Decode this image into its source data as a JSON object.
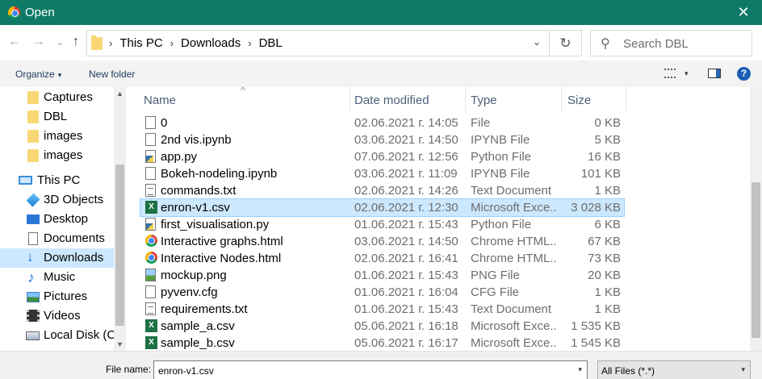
{
  "window": {
    "title": "Open",
    "close_glyph": "✕"
  },
  "nav": {
    "back_glyph": "←",
    "forward_glyph": "→",
    "recent_glyph": "⌄",
    "up_glyph": "↑"
  },
  "breadcrumb": {
    "items": [
      "This PC",
      "Downloads",
      "DBL"
    ],
    "separator": "›",
    "dropdown_glyph": "⌄"
  },
  "refresh_glyph": "↻",
  "search": {
    "placeholder": "Search DBL",
    "icon_glyph": "⚲"
  },
  "toolbar": {
    "organize": "Organize",
    "new_folder": "New folder",
    "caret": "▾",
    "help": "?"
  },
  "sidebar": {
    "items": [
      {
        "label": "Captures",
        "icon": "folder-icon"
      },
      {
        "label": "DBL",
        "icon": "folder-icon"
      },
      {
        "label": "images",
        "icon": "folder-icon"
      },
      {
        "label": "images",
        "icon": "folder-icon"
      },
      {
        "label": "This PC",
        "icon": "computer-icon"
      },
      {
        "label": "3D Objects",
        "icon": "3d-objects-icon"
      },
      {
        "label": "Desktop",
        "icon": "desktop-icon"
      },
      {
        "label": "Documents",
        "icon": "documents-icon"
      },
      {
        "label": "Downloads",
        "icon": "downloads-icon",
        "selected": true
      },
      {
        "label": "Music",
        "icon": "music-icon"
      },
      {
        "label": "Pictures",
        "icon": "pictures-icon"
      },
      {
        "label": "Videos",
        "icon": "videos-icon"
      },
      {
        "label": "Local Disk (C",
        "icon": "local-disk-icon"
      }
    ]
  },
  "columns": {
    "name": "Name",
    "date": "Date modified",
    "type": "Type",
    "size": "Size",
    "sort_glyph": "^"
  },
  "files": [
    {
      "name": "0",
      "date": "02.06.2021 г. 14:05",
      "type": "File",
      "size": "0 KB",
      "icon": "file-icon"
    },
    {
      "name": "2nd vis.ipynb",
      "date": "03.06.2021 г. 14:50",
      "type": "IPYNB File",
      "size": "5 KB",
      "icon": "file-icon"
    },
    {
      "name": "app.py",
      "date": "07.06.2021 г. 12:56",
      "type": "Python File",
      "size": "16 KB",
      "icon": "python-file-icon"
    },
    {
      "name": "Bokeh-nodeling.ipynb",
      "date": "03.06.2021 г. 11:09",
      "type": "IPYNB File",
      "size": "101 KB",
      "icon": "file-icon"
    },
    {
      "name": "commands.txt",
      "date": "02.06.2021 г. 14:26",
      "type": "Text Document",
      "size": "1 KB",
      "icon": "text-file-icon"
    },
    {
      "name": "enron-v1.csv",
      "date": "02.06.2021 г. 12:30",
      "type": "Microsoft Exce...",
      "size": "3 028 KB",
      "icon": "excel-file-icon",
      "selected": true
    },
    {
      "name": "first_visualisation.py",
      "date": "01.06.2021 г. 15:43",
      "type": "Python File",
      "size": "6 KB",
      "icon": "python-file-icon"
    },
    {
      "name": "Interactive graphs.html",
      "date": "03.06.2021 г. 14:50",
      "type": "Chrome HTML...",
      "size": "67 KB",
      "icon": "chrome-html-icon"
    },
    {
      "name": "Interactive Nodes.html",
      "date": "02.06.2021 г. 16:41",
      "type": "Chrome HTML...",
      "size": "73 KB",
      "icon": "chrome-html-icon"
    },
    {
      "name": "mockup.png",
      "date": "01.06.2021 г. 15:43",
      "type": "PNG File",
      "size": "20 KB",
      "icon": "image-file-icon"
    },
    {
      "name": "pyvenv.cfg",
      "date": "01.06.2021 г. 16:04",
      "type": "CFG File",
      "size": "1 KB",
      "icon": "file-icon"
    },
    {
      "name": "requirements.txt",
      "date": "01.06.2021 г. 15:43",
      "type": "Text Document",
      "size": "1 KB",
      "icon": "text-file-icon"
    },
    {
      "name": "sample_a.csv",
      "date": "05.06.2021 г. 16:18",
      "type": "Microsoft Exce...",
      "size": "1 535 KB",
      "icon": "excel-file-icon"
    },
    {
      "name": "sample_b.csv",
      "date": "05.06.2021 г. 16:17",
      "type": "Microsoft Exce...",
      "size": "1 545 KB",
      "icon": "excel-file-icon"
    }
  ],
  "scroll_glyphs": {
    "up": "▲",
    "down": "▼"
  },
  "bottom": {
    "file_name_label": "File name:",
    "file_name_value": "enron-v1.csv",
    "file_type": "All Files (*.*)",
    "dropdown_glyph": "▾"
  },
  "colors": {
    "titlebar": "#0e7a67",
    "selection": "#cce8ff",
    "excel": "#1d7044",
    "accent": "#1a5fb4"
  }
}
